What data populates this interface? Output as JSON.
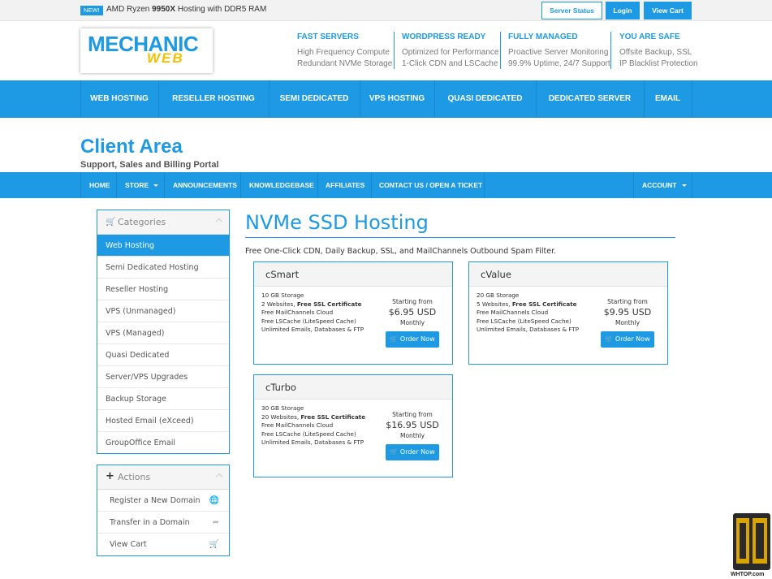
{
  "topbar": {
    "badge": "NEW!",
    "promo_pre": "AMD Ryzen ",
    "promo_bold": "9950X",
    "promo_post": " Hosting with DDR5 RAM",
    "server_status": "Server Status",
    "login": "Login",
    "view_cart": "View Cart"
  },
  "logo": {
    "top": "MECHANIC",
    "bottom": "WEB"
  },
  "features": [
    {
      "title": "FAST SERVERS",
      "line1": "High Frequency Compute",
      "line2": "Redundant NVMe Storage"
    },
    {
      "title": "WORDPRESS READY",
      "line1": "Optimized for Performance",
      "line2": "1-Click CDN and LSCache"
    },
    {
      "title": "FULLY MANAGED",
      "line1": "Proactive Server Monitoring",
      "line2": "99.9% Uptime, 24/7 Support"
    },
    {
      "title": "YOU ARE SAFE",
      "line1": "Offsite Backup, SSL",
      "line2": "IP Blacklist Protection"
    }
  ],
  "mainnav": [
    "WEB HOSTING",
    "RESELLER HOSTING",
    "SEMI DEDICATED",
    "VPS HOSTING",
    "QUASI DEDICATED",
    "DEDICATED SERVER",
    "EMAIL"
  ],
  "client_area": {
    "title": "Client Area",
    "subtitle": "Support, Sales and Billing Portal"
  },
  "subnav": {
    "home": "HOME",
    "store": "STORE",
    "announcements": "ANNOUNCEMENTS",
    "knowledgebase": "KNOWLEDGEBASE",
    "affiliates": "AFFILIATES",
    "contact": "CONTACT US / OPEN A TICKET",
    "account": "ACCOUNT"
  },
  "categories": {
    "title": "Categories",
    "items": [
      "Web Hosting",
      "Semi Dedicated Hosting",
      "Reseller Hosting",
      "VPS (Unmanaged)",
      "VPS (Managed)",
      "Quasi Dedicated",
      "Server/VPS Upgrades",
      "Backup Storage",
      "Hosted Email (eXceed)",
      "GroupOffice Email"
    ]
  },
  "actions": {
    "title": "Actions",
    "items": [
      "Register a New Domain",
      "Transfer in a Domain",
      "View Cart"
    ]
  },
  "main": {
    "title": "NVMe SSD Hosting",
    "description": "Free One-Click CDN, Daily Backup, SSL, and MailChannels Outbound Spam Filter."
  },
  "plans": [
    {
      "name": "cSmart",
      "storage": "10 GB Storage",
      "websites": "2 Websites, ",
      "ssl": "Free SSL Certificate",
      "mail": "Free MailChannels Cloud",
      "cache": "Free LSCache (LiteSpeed Cache)",
      "unlimited": "Unlimited Emails, Databases & FTP",
      "starting": "Starting from",
      "price": "$6.95 USD",
      "cycle": "Monthly",
      "order": "Order Now"
    },
    {
      "name": "cValue",
      "storage": "20 GB Storage",
      "websites": "5 Websites, ",
      "ssl": "Free SSL Certificate",
      "mail": "Free MailChannels Cloud",
      "cache": "Free LSCache (LiteSpeed Cache)",
      "unlimited": "Unlimited Emails, Databases & FTP",
      "starting": "Starting from",
      "price": "$9.95 USD",
      "cycle": "Monthly",
      "order": "Order Now"
    },
    {
      "name": "cTurbo",
      "storage": "30 GB Storage",
      "websites": "20 Websites, ",
      "ssl": "Free SSL Certificate",
      "mail": "Free MailChannels Cloud",
      "cache": "Free LSCache (LiteSpeed Cache)",
      "unlimited": "Unlimited Emails, Databases & FTP",
      "starting": "Starting from",
      "price": "$16.95 USD",
      "cycle": "Monthly",
      "order": "Order Now"
    }
  ],
  "watermark": {
    "text": "WHTOP.com"
  },
  "colors": {
    "accent": "#1d9ae3",
    "logo_yellow": "#f3c100"
  }
}
